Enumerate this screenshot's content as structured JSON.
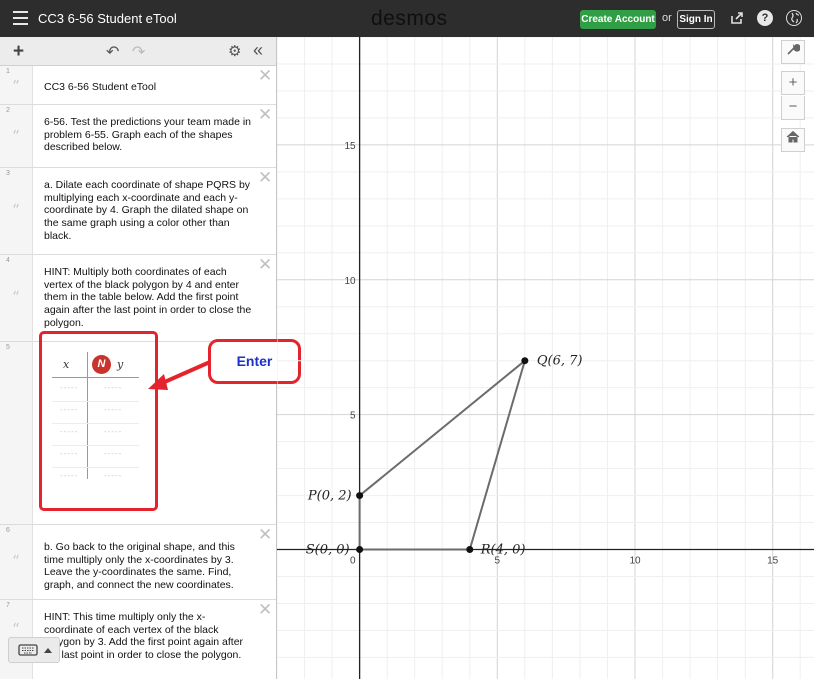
{
  "topbar": {
    "title": "CC3 6-56 Student eTool",
    "logo": "desmos",
    "create_account": "Create Account",
    "or": "or",
    "sign_in": "Sign In",
    "icons": [
      "menu-icon",
      "share-icon",
      "help-icon",
      "language-globe-icon"
    ]
  },
  "toolbar": {
    "add": "+",
    "icons": [
      "add-icon",
      "undo-icon",
      "redo-icon",
      "settings-gear-icon",
      "collapse-icon"
    ]
  },
  "expressions": [
    {
      "num": "1",
      "text": "CC3 6-56 Student eTool"
    },
    {
      "num": "2",
      "text": "6-56. Test the predictions your team made in problem 6-55. Graph each of the shapes described below."
    },
    {
      "num": "3",
      "text": "a. Dilate each coordinate of shape PQRS by multiplying each x-coordinate and each y-coordinate by 4. Graph the dilated shape on the same graph using a color other than black."
    },
    {
      "num": "4",
      "text": "HINT: Multiply both coordinates of each vertex of the black polygon by 4 and enter them in the table below. Add the first point again after the last point in order to close the polygon."
    },
    {
      "num": "5",
      "table": {
        "x_header": "x",
        "y_header": "y",
        "rows": 5,
        "placeholder": "-----"
      }
    },
    {
      "num": "6",
      "text": "b. Go back to the original shape, and this time multiply only the x-coordinates by 3. Leave the y-coordinates the same. Find, graph, and connect the new coordinates."
    },
    {
      "num": "7",
      "text": "HINT: This time multiply only the x-coordinate of each vertex of the black polygon by 3. Add the first point again after the last point in order to close the polygon."
    }
  ],
  "annotation": {
    "callout": "Enter",
    "color": "#e4242c"
  },
  "graph": {
    "x_range": [
      -3,
      16.5
    ],
    "y_range": [
      -4.8,
      19
    ],
    "x_ticks": [
      "5",
      "10",
      "15"
    ],
    "y_ticks": [
      "15",
      "10",
      "5"
    ],
    "origin_label": "0",
    "points": [
      {
        "label": "P(0, 2)",
        "x": 0,
        "y": 2
      },
      {
        "label": "Q(6, 7)",
        "x": 6,
        "y": 7
      },
      {
        "label": "R(4, 0)",
        "x": 4,
        "y": 0
      },
      {
        "label": "S(0, 0)",
        "x": 0,
        "y": 0
      }
    ],
    "polygon_color": "#6b6b6b",
    "side_icons": [
      "wrench-icon",
      "zoom-in-icon",
      "zoom-out-icon",
      "home-icon"
    ]
  }
}
